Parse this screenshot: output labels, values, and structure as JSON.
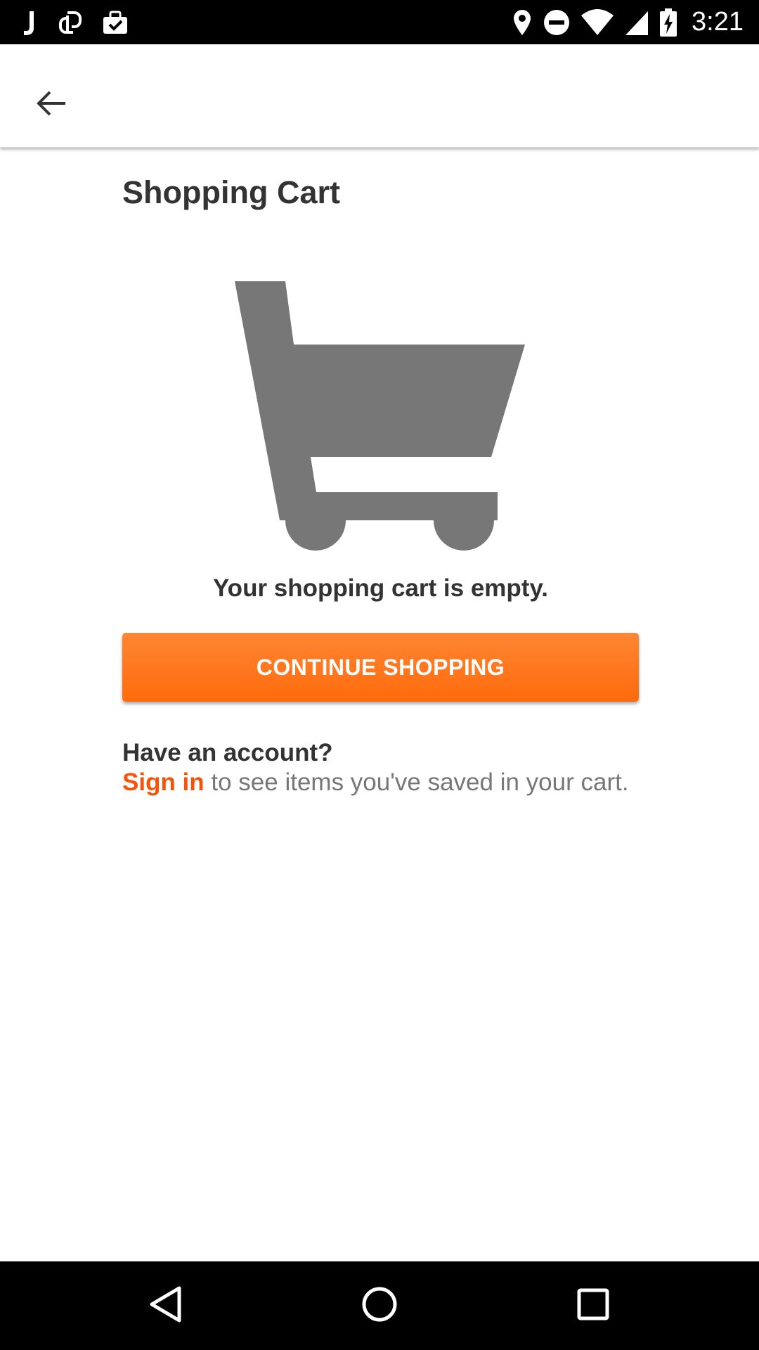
{
  "status_bar": {
    "time": "3:21",
    "left_icons": [
      "j-app-icon",
      "link-icon",
      "briefcase-check-icon"
    ],
    "right_icons": [
      "location-pin-icon",
      "do-not-disturb-icon",
      "wifi-icon",
      "cellular-signal-icon",
      "battery-charging-icon"
    ]
  },
  "app_bar": {
    "back_icon": "arrow-back-icon"
  },
  "main": {
    "title": "Shopping Cart",
    "illustration_icon": "shopping-cart-icon",
    "empty_message": "Your shopping cart is empty.",
    "continue_button_label": "CONTINUE SHOPPING",
    "account_heading": "Have an account?",
    "sign_in_link": "Sign in",
    "sign_in_suffix": " to see items you've saved in your cart."
  },
  "nav_bar": {
    "icons": [
      "back-triangle-icon",
      "home-circle-icon",
      "recents-square-icon"
    ]
  },
  "colors": {
    "accent": "#ff6a0c",
    "link": "#f5540a",
    "icon_gray": "#777777",
    "text_dark": "#333333"
  }
}
